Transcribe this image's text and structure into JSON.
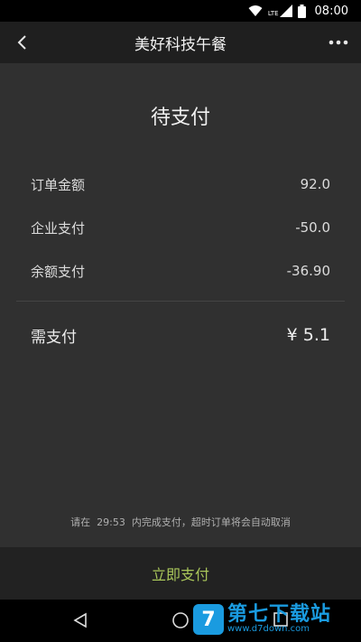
{
  "status_bar": {
    "network": "LTE",
    "time": "08:00"
  },
  "toolbar": {
    "title": "美好科技午餐"
  },
  "order": {
    "status": "待支付",
    "rows": [
      {
        "label": "订单金额",
        "value": "92.0"
      },
      {
        "label": "企业支付",
        "value": "-50.0"
      },
      {
        "label": "余额支付",
        "value": "-36.90"
      }
    ],
    "need_label": "需支付",
    "need_amount": "¥ 5.1"
  },
  "countdown": {
    "prefix": "请在",
    "time": "29:53",
    "suffix": "内完成支付，超时订单将会自动取消"
  },
  "pay_button": {
    "label": "立即支付"
  },
  "watermark": {
    "logo": "7",
    "text": "第七下载站",
    "url": "www.d7down.com"
  },
  "colors": {
    "accent": "#a9c65a",
    "watermark": "#1a9be0",
    "background": "#303030"
  }
}
